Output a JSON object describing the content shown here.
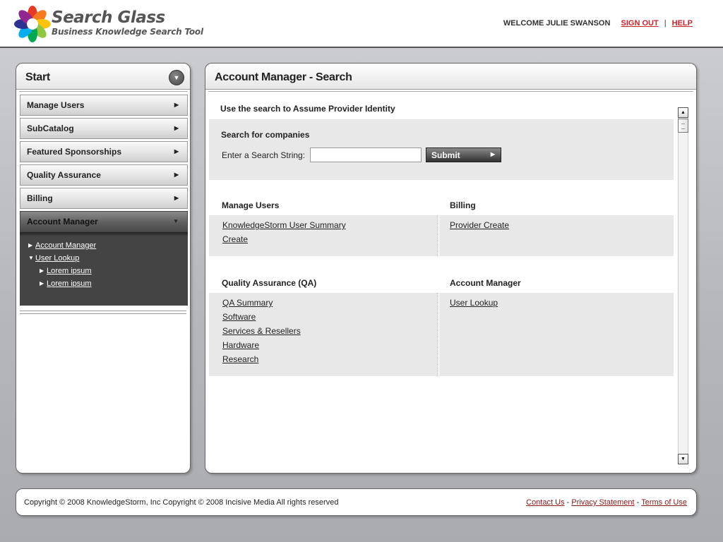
{
  "header": {
    "logo_title": "Search Glass",
    "logo_subtitle": "Business Knowledge Search Tool",
    "welcome": "WELCOME JULIE SWANSON",
    "sign_out": "SIGN OUT",
    "separator": "|",
    "help": "HELP"
  },
  "sidebar": {
    "title": "Start",
    "items": [
      {
        "label": "Manage Users"
      },
      {
        "label": "SubCatalog"
      },
      {
        "label": "Featured Sponsorships"
      },
      {
        "label": "Quality Assurance"
      },
      {
        "label": "Billing"
      },
      {
        "label": "Account Manager"
      }
    ],
    "active_item": "Account Manager",
    "subitems": [
      {
        "label": "Account Manager",
        "level": 1
      },
      {
        "label": "User Lookup",
        "level": 1,
        "expanded": true
      },
      {
        "label": "Lorem ipsum",
        "level": 2
      },
      {
        "label": "Lorem ipsum",
        "level": 2
      }
    ]
  },
  "main": {
    "title": "Account Manager - Search",
    "intro": "Use the search to Assume Provider Identity",
    "search": {
      "heading": "Search for companies",
      "label": "Enter a Search String:",
      "value": "",
      "placeholder": "",
      "submit_label": "Submit"
    },
    "sections": [
      {
        "left": {
          "title": "Manage Users",
          "links": [
            "KnowledgeStorm User Summary",
            "Create"
          ]
        },
        "right": {
          "title": "Billing",
          "links": [
            "Provider Create"
          ]
        }
      },
      {
        "left": {
          "title": "Quality Assurance (QA)",
          "links": [
            "QA Summary",
            "Software",
            "Services & Resellers",
            "Hardware",
            "Research"
          ]
        },
        "right": {
          "title": "Account Manager",
          "links": [
            "User Lookup"
          ]
        }
      }
    ]
  },
  "footer": {
    "copyright": "Copyright © 2008 KnowledgeStorm, Inc  Copyright © 2008 Incisive Media All rights reserved",
    "contact": "Contact Us",
    "privacy": "Privacy Statement",
    "terms": "Terms of Use",
    "dash": "-"
  },
  "colors": {
    "accent_red": "#c1272d",
    "footer_link": "#8b1a1a",
    "active_nav": "#4a4a4a"
  }
}
